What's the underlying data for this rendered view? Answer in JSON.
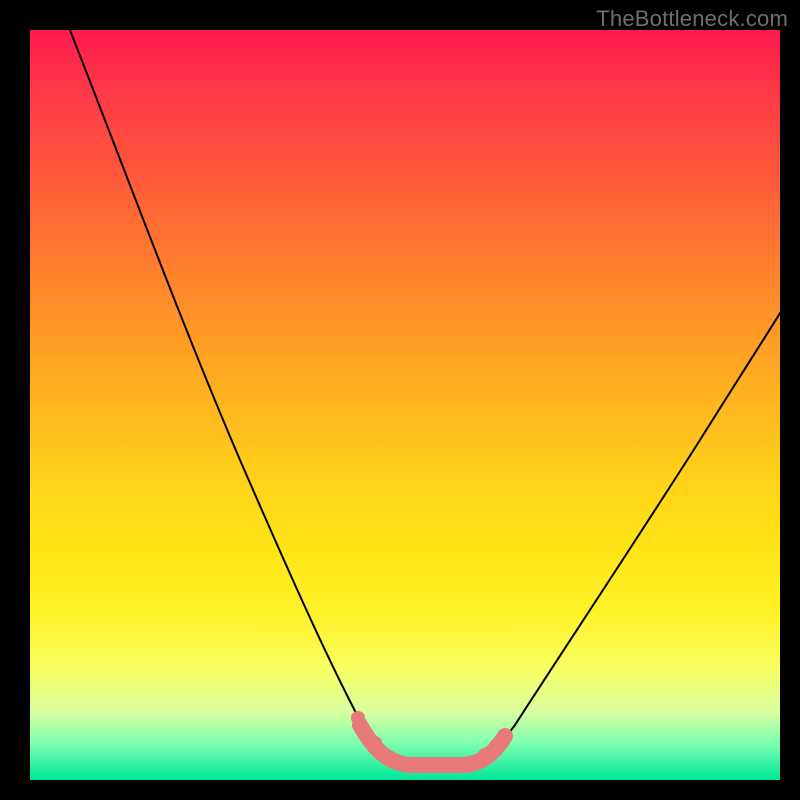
{
  "watermark": "TheBottleneck.com",
  "colors": {
    "dip_stroke": "#e87a7a",
    "curve_stroke": "#000000",
    "gradient_top": "#ff1a4d",
    "gradient_bottom": "#00e69a"
  },
  "chart_data": {
    "type": "line",
    "title": "",
    "xlabel": "",
    "ylabel": "",
    "xlim": [
      0,
      100
    ],
    "ylim": [
      0,
      100
    ],
    "grid": false,
    "legend": false,
    "note": "No axis ticks or numeric labels are rendered; values are read as percentage of plot area.",
    "series": [
      {
        "name": "left-arm",
        "x": [
          5,
          10,
          15,
          20,
          25,
          30,
          35,
          40,
          44,
          46,
          48
        ],
        "y": [
          100,
          88,
          77,
          66,
          55,
          43,
          31,
          19,
          9,
          5,
          3
        ]
      },
      {
        "name": "valley-floor",
        "x": [
          48,
          50,
          52,
          54,
          56,
          58,
          60
        ],
        "y": [
          3,
          2.5,
          2.3,
          2.3,
          2.4,
          2.7,
          3
        ]
      },
      {
        "name": "right-arm",
        "x": [
          60,
          63,
          67,
          72,
          78,
          85,
          92,
          100
        ],
        "y": [
          3,
          6,
          12,
          20,
          31,
          43,
          54,
          66
        ]
      }
    ],
    "highlight": {
      "name": "optimal-range",
      "x_range": [
        44,
        62
      ],
      "y_approx": 3,
      "color": "#e87a7a"
    }
  }
}
